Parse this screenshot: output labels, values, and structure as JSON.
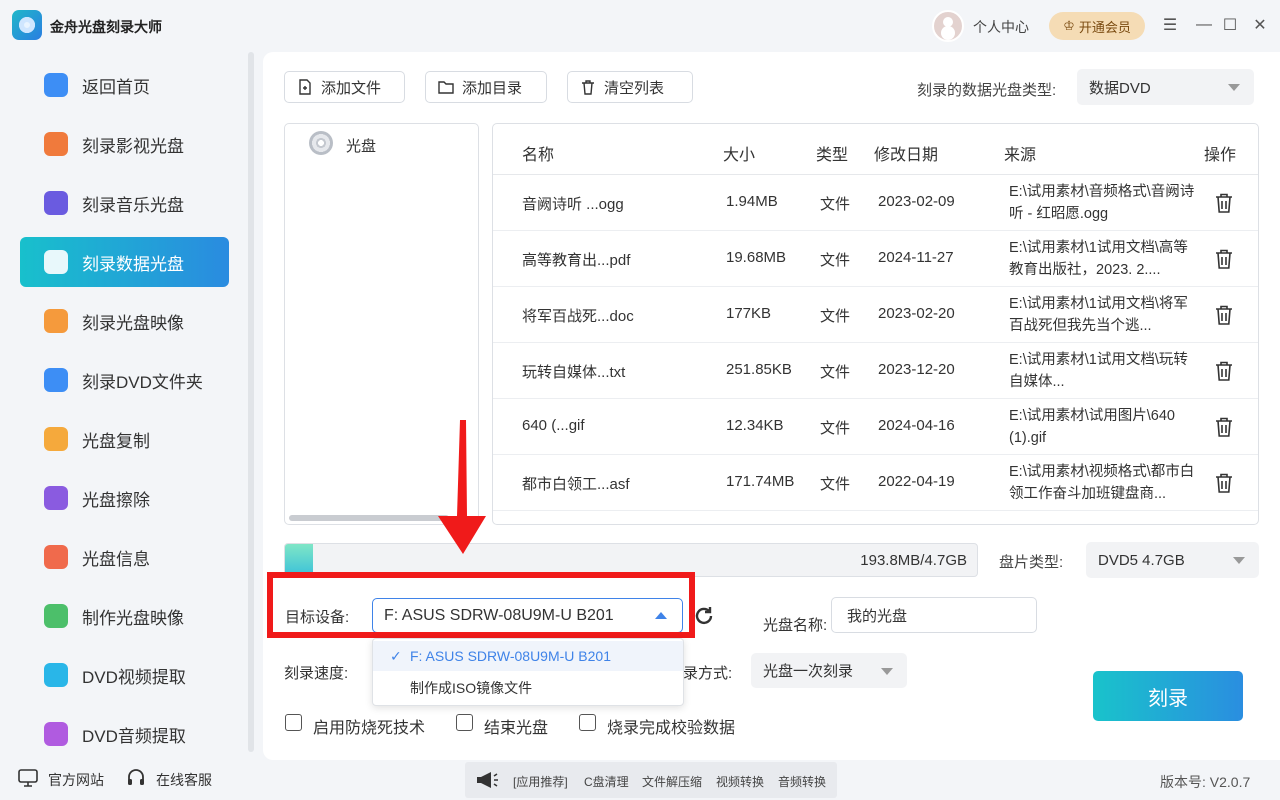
{
  "app": {
    "title": "金舟光盘刻录大师",
    "user_center": "个人中心",
    "vip_label": "开通会员"
  },
  "sidebar": {
    "items": [
      {
        "label": "返回首页",
        "icon": "home-icon",
        "color": "#3d8ef5"
      },
      {
        "label": "刻录影视光盘",
        "icon": "video-disc-icon",
        "color": "#f07a3c"
      },
      {
        "label": "刻录音乐光盘",
        "icon": "music-disc-icon",
        "color": "#6a5be0"
      },
      {
        "label": "刻录数据光盘",
        "icon": "data-disc-icon",
        "color": "#ffffff"
      },
      {
        "label": "刻录光盘映像",
        "icon": "disc-image-icon",
        "color": "#f59a3c"
      },
      {
        "label": "刻录DVD文件夹",
        "icon": "dvd-folder-icon",
        "color": "#3d8ef5"
      },
      {
        "label": "光盘复制",
        "icon": "disc-copy-icon",
        "color": "#f5a93c"
      },
      {
        "label": "光盘擦除",
        "icon": "disc-erase-icon",
        "color": "#8a5be0"
      },
      {
        "label": "光盘信息",
        "icon": "disc-info-icon",
        "color": "#f06a4c"
      },
      {
        "label": "制作光盘映像",
        "icon": "make-image-icon",
        "color": "#4cbf6a"
      },
      {
        "label": "DVD视频提取",
        "icon": "dvd-video-extract-icon",
        "color": "#29b6e8"
      },
      {
        "label": "DVD音频提取",
        "icon": "dvd-audio-extract-icon",
        "color": "#b05be0"
      }
    ],
    "active_index": 3
  },
  "toolbar": {
    "add_file": "添加文件",
    "add_folder": "添加目录",
    "clear_list": "清空列表",
    "disc_type_label": "刻录的数据光盘类型:",
    "disc_type_value": "数据DVD"
  },
  "tree": {
    "root_label": "光盘"
  },
  "table": {
    "headers": {
      "name": "名称",
      "size": "大小",
      "type": "类型",
      "date": "修改日期",
      "source": "来源",
      "action": "操作"
    },
    "rows": [
      {
        "name": "音阙诗听 ...ogg",
        "size": "1.94MB",
        "type": "文件",
        "date": "2023-02-09",
        "source": "E:\\试用素材\\音频格式\\音阙诗听 - 红昭愿.ogg"
      },
      {
        "name": "高等教育出...pdf",
        "size": "19.68MB",
        "type": "文件",
        "date": "2024-11-27",
        "source": "E:\\试用素材\\1试用文档\\高等教育出版社，2023. 2...."
      },
      {
        "name": "将军百战死...doc",
        "size": "177KB",
        "type": "文件",
        "date": "2023-02-20",
        "source": "E:\\试用素材\\1试用文档\\将军百战死但我先当个逃..."
      },
      {
        "name": "玩转自媒体...txt",
        "size": "251.85KB",
        "type": "文件",
        "date": "2023-12-20",
        "source": "E:\\试用素材\\1试用文档\\玩转自媒体..."
      },
      {
        "name": "640 (...gif",
        "size": "12.34KB",
        "type": "文件",
        "date": "2024-04-16",
        "source": "E:\\试用素材\\试用图片\\640 (1).gif"
      },
      {
        "name": "都市白领工...asf",
        "size": "171.74MB",
        "type": "文件",
        "date": "2022-04-19",
        "source": "E:\\试用素材\\视频格式\\都市白领工作奋斗加班键盘商..."
      }
    ]
  },
  "capacity": {
    "text": "193.8MB/4.7GB",
    "fill_fraction": 0.04,
    "disc_kind_label": "盘片类型:",
    "disc_kind_value": "DVD5 4.7GB"
  },
  "target": {
    "label": "目标设备:",
    "value": "F: ASUS SDRW-08U9M-U B201",
    "options": [
      "F: ASUS SDRW-08U9M-U B201",
      "制作成ISO镜像文件"
    ]
  },
  "disc_name": {
    "label": "光盘名称:",
    "value": "我的光盘"
  },
  "speed": {
    "label": "刻录速度:"
  },
  "method": {
    "label_partial": "录方式:",
    "value": "光盘一次刻录"
  },
  "burn_button": "刻录",
  "options": {
    "anti_burn": "启用防烧死技术",
    "finalize": "结束光盘",
    "verify": "烧录完成校验数据"
  },
  "footer": {
    "website": "官方网站",
    "support": "在线客服",
    "promo_label": "[应用推荐]",
    "promo_items": [
      "C盘清理",
      "文件解压缩",
      "视频转换",
      "音频转换"
    ],
    "version": "版本号: V2.0.7"
  },
  "colors": {
    "accent": "#2a8be0",
    "highlight": "#f01a1a"
  }
}
